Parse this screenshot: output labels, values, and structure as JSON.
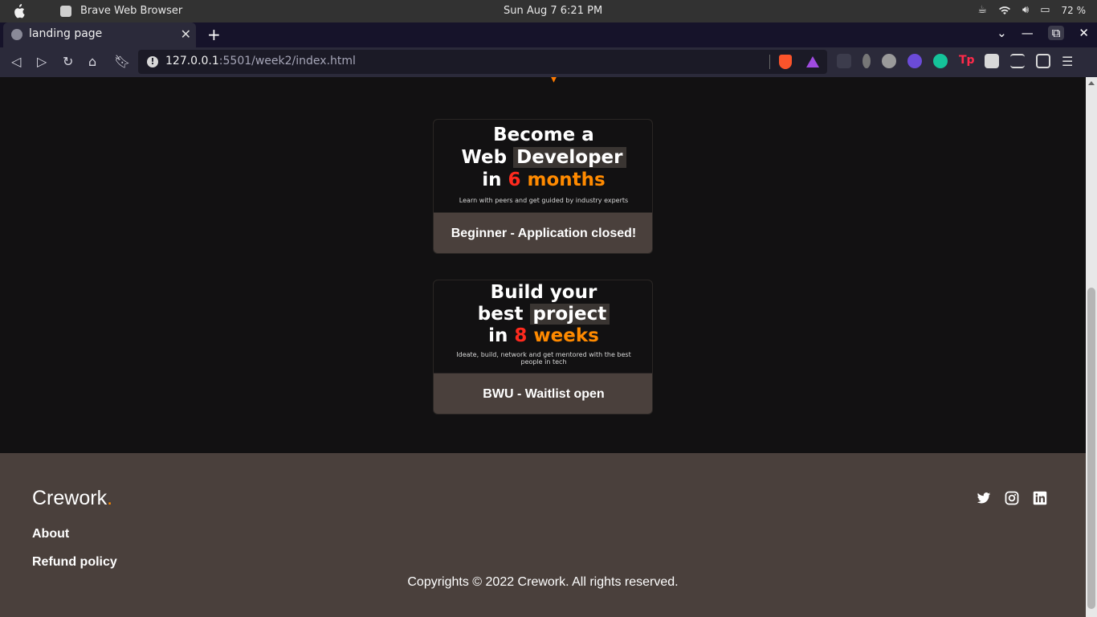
{
  "os_bar": {
    "app_name": "Brave Web Browser",
    "clock": "Sun Aug 7   6:21 PM",
    "battery": "72 %"
  },
  "browser": {
    "tab_title": "landing page",
    "tab_close": "✕",
    "new_tab": "+",
    "url_host": "127.0.0.1",
    "url_rest": ":5501/week2/index.html",
    "win_controls": {
      "menu": "⌄",
      "minimize": "—",
      "restore": "⧉",
      "close": "✕"
    },
    "nav": {
      "back": "◁",
      "forward": "▷",
      "reload": "↻",
      "home": "⌂",
      "bookmark": "🔖︎"
    },
    "extensions": [
      "more-icon",
      "mouse-icon",
      "cloud-blocked-icon",
      "check-circle-icon",
      "grammarly-icon",
      "tp-icon",
      "puzzle-icon",
      "playlist-icon",
      "wallet-icon",
      "menu-icon"
    ]
  },
  "cards": [
    {
      "banner": {
        "line1": "Become a",
        "line2_a": "Web ",
        "line2_b": "Developer",
        "line3_a": "in ",
        "line3_num": "6",
        "line3_word": " months",
        "sub": "Learn with peers and get guided by industry experts"
      },
      "label": "Beginner - Application closed!"
    },
    {
      "banner": {
        "line1": "Build your",
        "line2_a": "best ",
        "line2_b": "project",
        "line3_a": "in ",
        "line3_num": "8",
        "line3_word": " weeks",
        "sub": "Ideate, build, network and get mentored with the best people in tech"
      },
      "label": "BWU - Waitlist open"
    }
  ],
  "footer": {
    "brand": "Crework",
    "brand_dot": ".",
    "links": [
      "About",
      "Refund policy"
    ],
    "copyright": "Copyrights © 2022 Crework. All rights reserved.",
    "social": [
      "twitter-icon",
      "instagram-icon",
      "linkedin-icon"
    ]
  },
  "colors": {
    "accent_orange": "#ff8a00",
    "accent_red": "#ff2a1e",
    "footer_bg": "#4a403c",
    "page_bg": "#121112"
  }
}
